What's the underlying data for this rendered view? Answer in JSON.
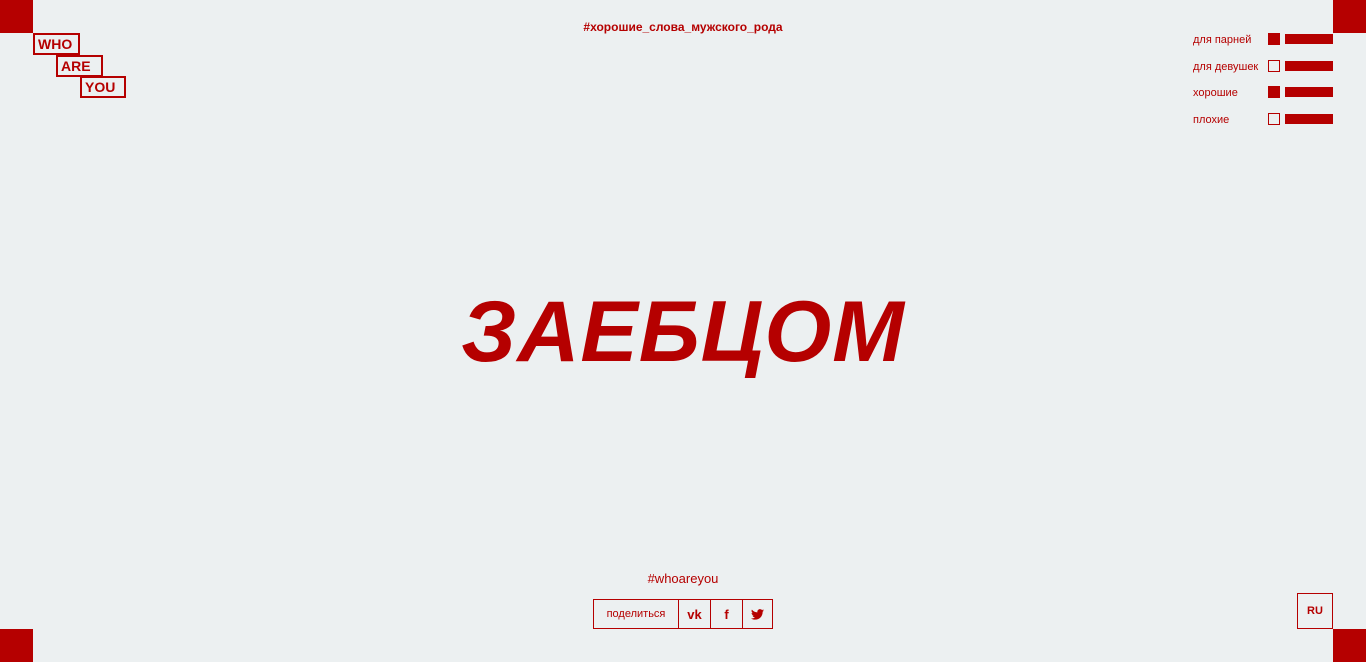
{
  "logo": {
    "line1": "WHO",
    "line2": "ARE",
    "line3": "YOU"
  },
  "hashtag_top": "#хорошие_слова_мужского_рода",
  "filters": [
    {
      "label": "для парней",
      "checked": true
    },
    {
      "label": "для девушек",
      "checked": false
    },
    {
      "label": "хорошие",
      "checked": true
    },
    {
      "label": "плохие",
      "checked": false
    }
  ],
  "main_word": "ЗАЕБЦОМ",
  "hashtag_bottom": "#whoareyou",
  "share": {
    "label": "поделиться",
    "buttons": [
      {
        "icon": "vk-icon",
        "glyph": "vk"
      },
      {
        "icon": "facebook-icon",
        "glyph": "f"
      },
      {
        "icon": "twitter-icon",
        "glyph": "✓"
      }
    ]
  },
  "language": "RU",
  "colors": {
    "accent": "#b50000",
    "background": "#ecf0f1"
  }
}
